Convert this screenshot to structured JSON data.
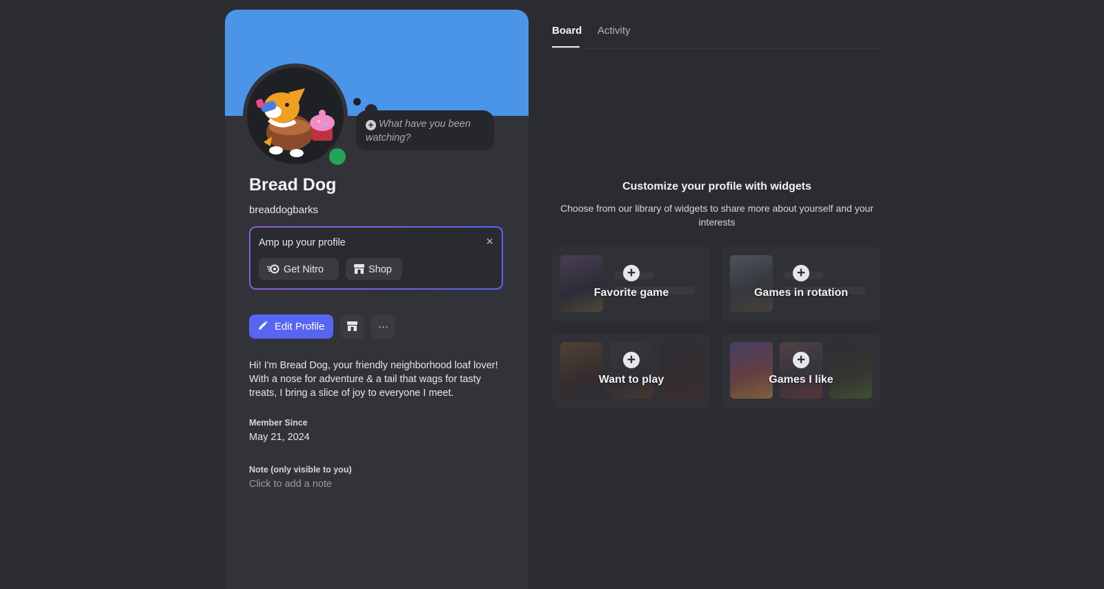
{
  "status": {
    "placeholder": "What have you been watching?",
    "icon": "plus-circle-icon"
  },
  "profile": {
    "display_name": "Bread Dog",
    "username": "breaddogbarks",
    "status_color": "#23a559",
    "banner_color": "#4b95e9"
  },
  "amp": {
    "title": "Amp up your profile",
    "close_icon": "×",
    "nitro_label": "Get Nitro",
    "shop_label": "Shop"
  },
  "actions": {
    "edit_label": "Edit Profile",
    "shop_icon": "shop-icon",
    "more_icon": "···",
    "accent": "#5865f2"
  },
  "bio": "Hi! I'm Bread Dog, your friendly neighborhood loaf lover! With a nose for adventure & a tail that wags for tasty treats, I bring a slice of joy to everyone I meet.",
  "member_since": {
    "label": "Member Since",
    "value": "May 21, 2024"
  },
  "note": {
    "label": "Note (only visible to you)",
    "placeholder": "Click to add a note"
  },
  "tabs": [
    {
      "label": "Board",
      "active": true
    },
    {
      "label": "Activity",
      "active": false
    }
  ],
  "widgets": {
    "title": "Customize your profile with widgets",
    "subtitle": "Choose from our library of widgets to share more about yourself and your interests",
    "items": [
      {
        "label": "Favorite game"
      },
      {
        "label": "Games in rotation"
      },
      {
        "label": "Want to play"
      },
      {
        "label": "Games I like"
      }
    ]
  }
}
